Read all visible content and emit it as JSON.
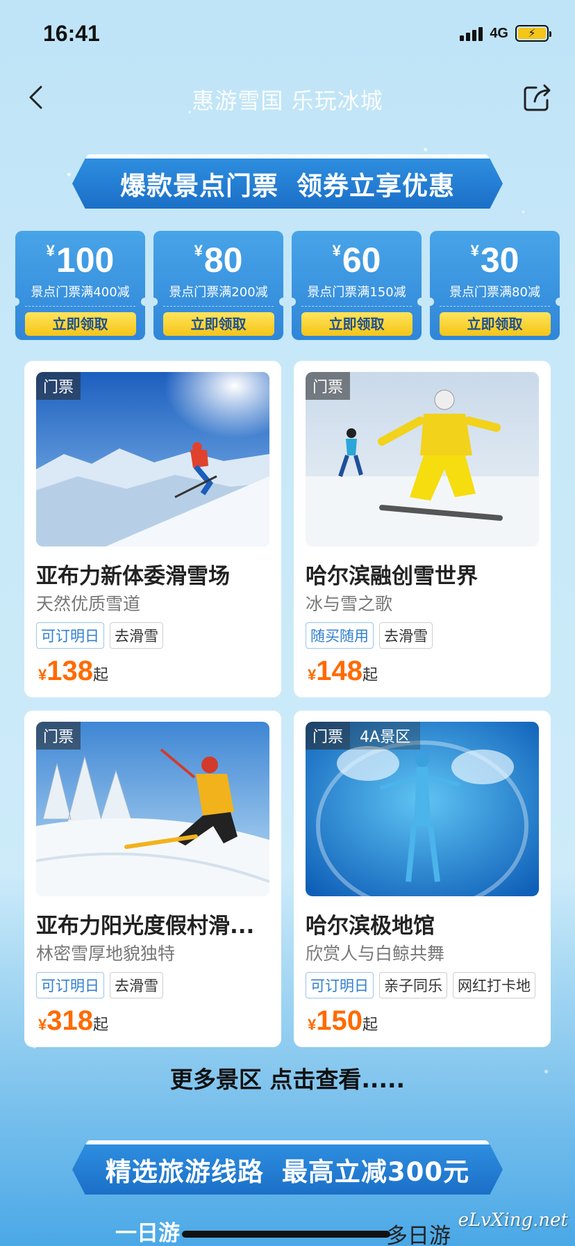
{
  "status_bar": {
    "time": "16:41",
    "network": "4G"
  },
  "nav": {
    "title": "惠游雪国 乐玩冰城"
  },
  "banner_top": {
    "left": "爆款景点门票",
    "right": "领券立享优惠"
  },
  "coupons": [
    {
      "currency": "¥",
      "amount": "100",
      "desc": "景点门票满400减",
      "button": "立即领取"
    },
    {
      "currency": "¥",
      "amount": "80",
      "desc": "景点门票满200减",
      "button": "立即领取"
    },
    {
      "currency": "¥",
      "amount": "60",
      "desc": "景点门票满150减",
      "button": "立即领取"
    },
    {
      "currency": "¥",
      "amount": "30",
      "desc": "景点门票满80减",
      "button": "立即领取"
    }
  ],
  "cards": [
    {
      "tag": "门票",
      "title": "亚布力新体委滑雪场",
      "subtitle": "天然优质雪道",
      "chips": [
        "可订明日",
        "去滑雪"
      ],
      "currency": "¥",
      "price": "138",
      "suffix": "起"
    },
    {
      "tag": "门票",
      "title": "哈尔滨融创雪世界",
      "subtitle": "冰与雪之歌",
      "chips": [
        "随买随用",
        "去滑雪"
      ],
      "currency": "¥",
      "price": "148",
      "suffix": "起"
    },
    {
      "tag": "门票",
      "title": "亚布力阳光度假村滑...",
      "subtitle": "林密雪厚地貌独特",
      "chips": [
        "可订明日",
        "去滑雪"
      ],
      "currency": "¥",
      "price": "318",
      "suffix": "起"
    },
    {
      "tag": "门票",
      "tag2": "4A景区",
      "title": "哈尔滨极地馆",
      "subtitle": "欣赏人与白鲸共舞",
      "chips": [
        "可订明日",
        "亲子同乐",
        "网红打卡地"
      ],
      "currency": "¥",
      "price": "150",
      "suffix": "起"
    }
  ],
  "more_link": "更多景区 点击查看.....",
  "banner_bottom": {
    "left": "精选旅游线路",
    "right": "最高立减300元"
  },
  "tabs": [
    "一日游",
    "多日游"
  ],
  "watermark": "eLvXing.net"
}
